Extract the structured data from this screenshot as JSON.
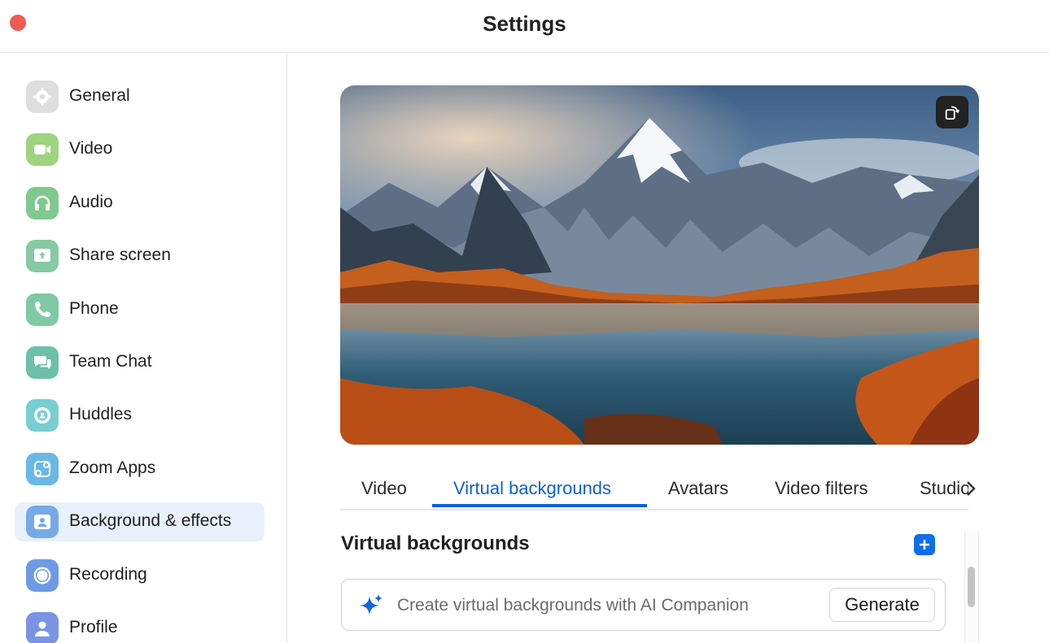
{
  "window": {
    "title": "Settings"
  },
  "colors": {
    "accent": "#0e5fd8",
    "close": "#f05a52",
    "active_bg": "#e8f0fb"
  },
  "sidebar": {
    "items": [
      {
        "label": "General",
        "icon": "gear-icon",
        "color": "#dcdcdc",
        "active": false
      },
      {
        "label": "Video",
        "icon": "camera-icon",
        "color": "#9ed47f",
        "active": false
      },
      {
        "label": "Audio",
        "icon": "headphones-icon",
        "color": "#7fc98e",
        "active": false
      },
      {
        "label": "Share screen",
        "icon": "share-screen-icon",
        "color": "#86caa3",
        "active": false
      },
      {
        "label": "Phone",
        "icon": "phone-icon",
        "color": "#7fc9a5",
        "active": false
      },
      {
        "label": "Team Chat",
        "icon": "chat-icon",
        "color": "#6cc0a9",
        "active": false
      },
      {
        "label": "Huddles",
        "icon": "huddles-icon",
        "color": "#77cfd0",
        "active": false
      },
      {
        "label": "Zoom Apps",
        "icon": "apps-icon",
        "color": "#6ab8e6",
        "active": false
      },
      {
        "label": "Background & effects",
        "icon": "background-person-icon",
        "color": "#76a9e8",
        "active": true
      },
      {
        "label": "Recording",
        "icon": "record-icon",
        "color": "#6d9ae6",
        "active": false
      },
      {
        "label": "Profile",
        "icon": "profile-icon",
        "color": "#7a93e4",
        "active": false
      }
    ]
  },
  "main": {
    "tabs": [
      {
        "label": "Video",
        "active": false
      },
      {
        "label": "Virtual backgrounds",
        "active": true
      },
      {
        "label": "Avatars",
        "active": false
      },
      {
        "label": "Video filters",
        "active": false
      },
      {
        "label": "Studio",
        "active": false
      }
    ],
    "section_title": "Virtual backgrounds",
    "ai_placeholder": "Create virtual backgrounds with AI Companion",
    "generate_label": "Generate"
  }
}
